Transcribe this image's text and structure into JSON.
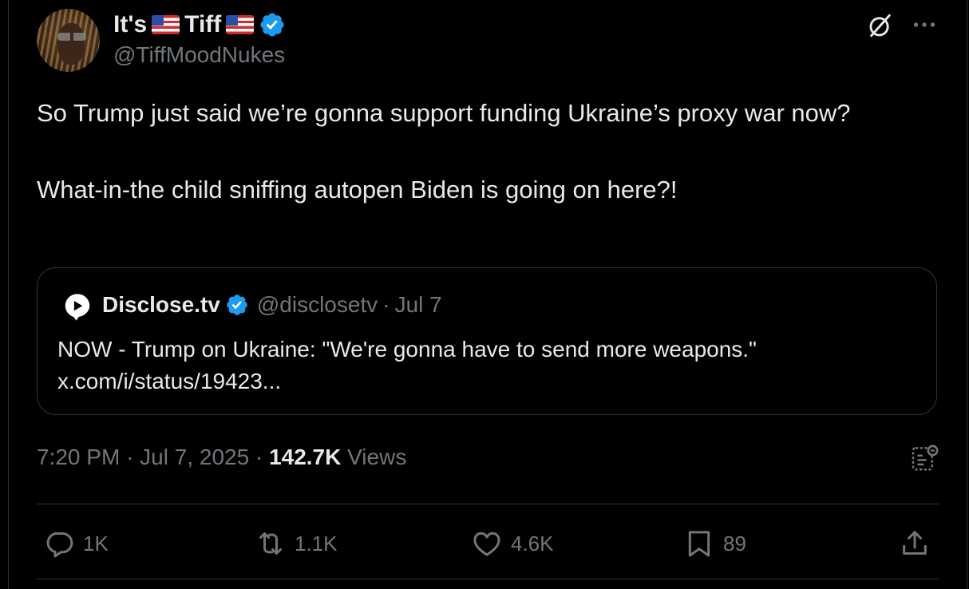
{
  "author": {
    "name_prefix": "It's",
    "name_suffix": "Tiff",
    "handle": "@TiffMoodNukes",
    "verified": true
  },
  "tweet": {
    "paragraphs": [
      "So Trump just said we’re gonna support funding Ukraine’s proxy war now?",
      "What-in-the child sniffing autopen Biden is going on here?!"
    ]
  },
  "quote": {
    "name": "Disclose.tv",
    "handle": "@disclosetv",
    "separator": "·",
    "date": "Jul 7",
    "text": "NOW - Trump on Ukraine: \"We're gonna have to send more weapons.\"",
    "link": "x.com/i/status/19423..."
  },
  "meta": {
    "time": "7:20 PM",
    "date": "Jul 7, 2025",
    "separator": "·",
    "views_count": "142.7K",
    "views_label": "Views"
  },
  "actions": {
    "replies": "1K",
    "reposts": "1.1K",
    "likes": "4.6K",
    "bookmarks": "89"
  },
  "colors": {
    "background": "#000000",
    "text": "#e7e9ea",
    "muted": "#71767b",
    "border": "#2f3336",
    "verified_blue": "#1d9bf0"
  },
  "icons": [
    "verified-badge-icon",
    "grok-icon",
    "more-icon",
    "disclose-logo-icon",
    "analytics-icon",
    "reply-icon",
    "repost-icon",
    "like-icon",
    "bookmark-icon",
    "share-icon",
    "us-flag-icon"
  ]
}
